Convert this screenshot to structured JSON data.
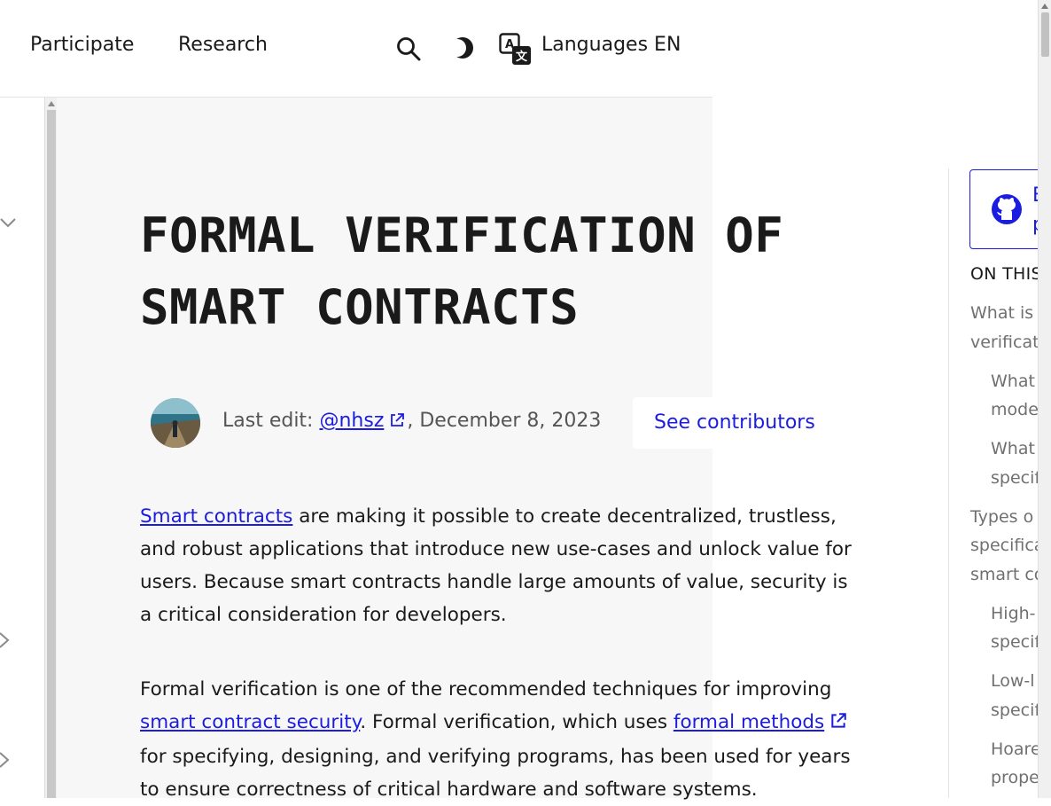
{
  "nav": {
    "participate": "Participate",
    "research": "Research",
    "languages_label": "Languages",
    "languages_code": "EN"
  },
  "article": {
    "title_line1": "FORMAL VERIFICATION OF",
    "title_line2": "SMART CONTRACTS",
    "last_edit_prefix": "Last edit: ",
    "last_edit_user": "@nhsz",
    "last_edit_date": ", December 8, 2023",
    "see_contributors": "See contributors",
    "p1_link": "Smart contracts",
    "p1_text": " are making it possible to create decentralized, trustless, and robust applications that introduce new use-cases and unlock value for users. Because smart contracts handle large amounts of value, security is a critical consideration for developers.",
    "p2_text_a": "Formal verification is one of the recommended techniques for improving ",
    "p2_link_a": "smart contract security",
    "p2_text_b": ". Formal verification, which uses ",
    "p2_link_b": "formal methods",
    "p2_text_c": " for specifying, designing, and verifying programs, has been used for years to ensure correctness of critical hardware and software systems."
  },
  "toc": {
    "edit_line1": "E",
    "edit_line2": "p",
    "heading": "ON THIS",
    "items": [
      "What is",
      "verificat",
      "What",
      "mode",
      "What",
      "specif",
      "Types o",
      "specifica",
      "smart co",
      "High-",
      "specif",
      "Low-l",
      "specif",
      "Hoare",
      "prope"
    ]
  },
  "colors": {
    "link": "#1c1ce1",
    "muted_text": "#707070",
    "content_bg": "#f7f7f7"
  }
}
